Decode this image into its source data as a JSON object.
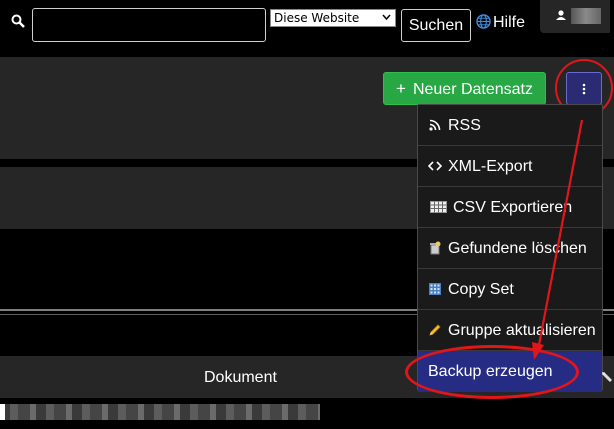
{
  "topbar": {
    "search_placeholder": "",
    "scope_selected": "Diese Website",
    "search_label": "Suchen",
    "help_label": "Hilfe"
  },
  "toolbar": {
    "new_record_label": "Neuer Datensatz"
  },
  "dropdown": {
    "items": [
      {
        "label": "RSS",
        "icon": "rss-icon"
      },
      {
        "label": "XML-Export",
        "icon": "code-icon"
      },
      {
        "label": "CSV Exportieren",
        "icon": "table-icon"
      },
      {
        "label": "Gefundene löschen",
        "icon": "delete-found-icon"
      },
      {
        "label": "Copy Set",
        "icon": "copy-set-icon"
      },
      {
        "label": "Gruppe aktualisieren",
        "icon": "pencil-icon"
      },
      {
        "label": "Backup erzeugen",
        "icon": "backup-icon"
      }
    ]
  },
  "table": {
    "column_document": "Dokument"
  },
  "colors": {
    "accent_green": "#28a745",
    "accent_blue": "#2a2b72",
    "highlight_red": "#e0161b",
    "menu_active": "#262b84"
  }
}
